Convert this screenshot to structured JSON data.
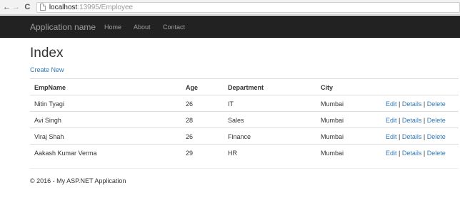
{
  "browser": {
    "url_host": "localhost",
    "url_rest": ":13995/Employee"
  },
  "navbar": {
    "brand": "Application name",
    "links": [
      "Home",
      "About",
      "Contact"
    ]
  },
  "page": {
    "title": "Index",
    "create_new": "Create New"
  },
  "table": {
    "headers": [
      "EmpName",
      "Age",
      "Department",
      "City"
    ],
    "rows": [
      {
        "name": "Nitin Tyagi",
        "age": "26",
        "department": "IT",
        "city": "Mumbai"
      },
      {
        "name": "Avi Singh",
        "age": "28",
        "department": "Sales",
        "city": "Mumbai"
      },
      {
        "name": "Viraj Shah",
        "age": "26",
        "department": "Finance",
        "city": "Mumbai"
      },
      {
        "name": "Aakash Kumar Verma",
        "age": "29",
        "department": "HR",
        "city": "Mumbai"
      }
    ],
    "actions": {
      "edit": "Edit",
      "details": "Details",
      "delete": "Delete",
      "separator": "|"
    }
  },
  "footer": {
    "text": "© 2016 - My ASP.NET Application"
  }
}
